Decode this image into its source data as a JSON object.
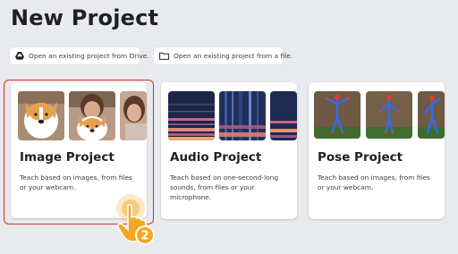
{
  "page": {
    "title": "New Project"
  },
  "open_buttons": {
    "drive": {
      "label": "Open an existing project from Drive.",
      "icon": "google-drive-icon"
    },
    "file": {
      "label": "Open an existing project from a file.",
      "icon": "folder-icon"
    }
  },
  "cards": {
    "image": {
      "title": "Image Project",
      "description": "Teach based on images, from files or your webcam."
    },
    "audio": {
      "title": "Audio Project",
      "description": "Teach based on one-second-long sounds, from files or your microphone."
    },
    "pose": {
      "title": "Pose Project",
      "description": "Teach based on images, from files or your webcam."
    }
  },
  "annotation": {
    "step_number": "2",
    "color": "#f5a623",
    "highlight_color": "#d93025"
  },
  "colors": {
    "background": "#e8eaed",
    "card": "#ffffff",
    "text": "#202124",
    "pose_skeleton": "#2a6cff"
  }
}
